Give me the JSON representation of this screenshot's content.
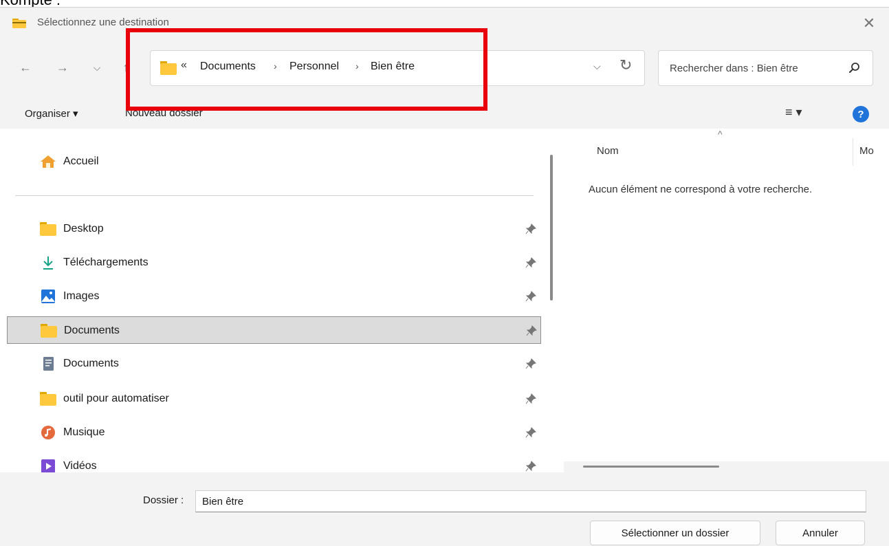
{
  "above_text": "Kompte :",
  "dialog": {
    "title": "Sélectionnez une destination",
    "close_glyph": "✕"
  },
  "nav": {
    "back_glyph": "←",
    "forward_glyph": "→",
    "history_glyph": "⌵",
    "up_glyph": "↑"
  },
  "address": {
    "overflow_glyph": "«",
    "crumbs": [
      "Documents",
      "Personnel",
      "Bien être"
    ],
    "separator": "›",
    "dropdown_glyph": "⌵",
    "refresh_glyph": "↻"
  },
  "search": {
    "placeholder": "Rechercher dans : Bien être"
  },
  "toolbar": {
    "organize_label": "Organiser ▾",
    "new_folder_label": "Nouveau dossier",
    "view_label": "≡ ▾",
    "help_label": "?"
  },
  "sidebar": {
    "items": [
      {
        "label": "Accueil",
        "icon": "home-icon"
      },
      {
        "label": "Desktop",
        "icon": "folder-icon",
        "pinned": true
      },
      {
        "label": "Téléchargements",
        "icon": "download-icon",
        "pinned": true
      },
      {
        "label": "Images",
        "icon": "images-icon",
        "pinned": true
      },
      {
        "label": "Documents",
        "icon": "folder-icon",
        "pinned": true,
        "selected": true
      },
      {
        "label": "Documents",
        "icon": "document-icon",
        "pinned": true
      },
      {
        "label": "outil pour automatiser",
        "icon": "folder-icon",
        "pinned": true
      },
      {
        "label": "Musique",
        "icon": "music-icon",
        "pinned": true
      },
      {
        "label": "Vidéos",
        "icon": "video-icon",
        "pinned": true
      }
    ]
  },
  "content": {
    "sort_glyph": "^",
    "col_name": "Nom",
    "col_modified": "Mo",
    "empty_message": "Aucun élément ne correspond à votre recherche."
  },
  "footer": {
    "folder_label": "Dossier :",
    "folder_value": "Bien être",
    "select_button": "Sélectionner un dossier",
    "cancel_button": "Annuler"
  },
  "colors": {
    "highlight": "#e8000b",
    "folder": "#ffc83d",
    "accent": "#1f73d9"
  }
}
